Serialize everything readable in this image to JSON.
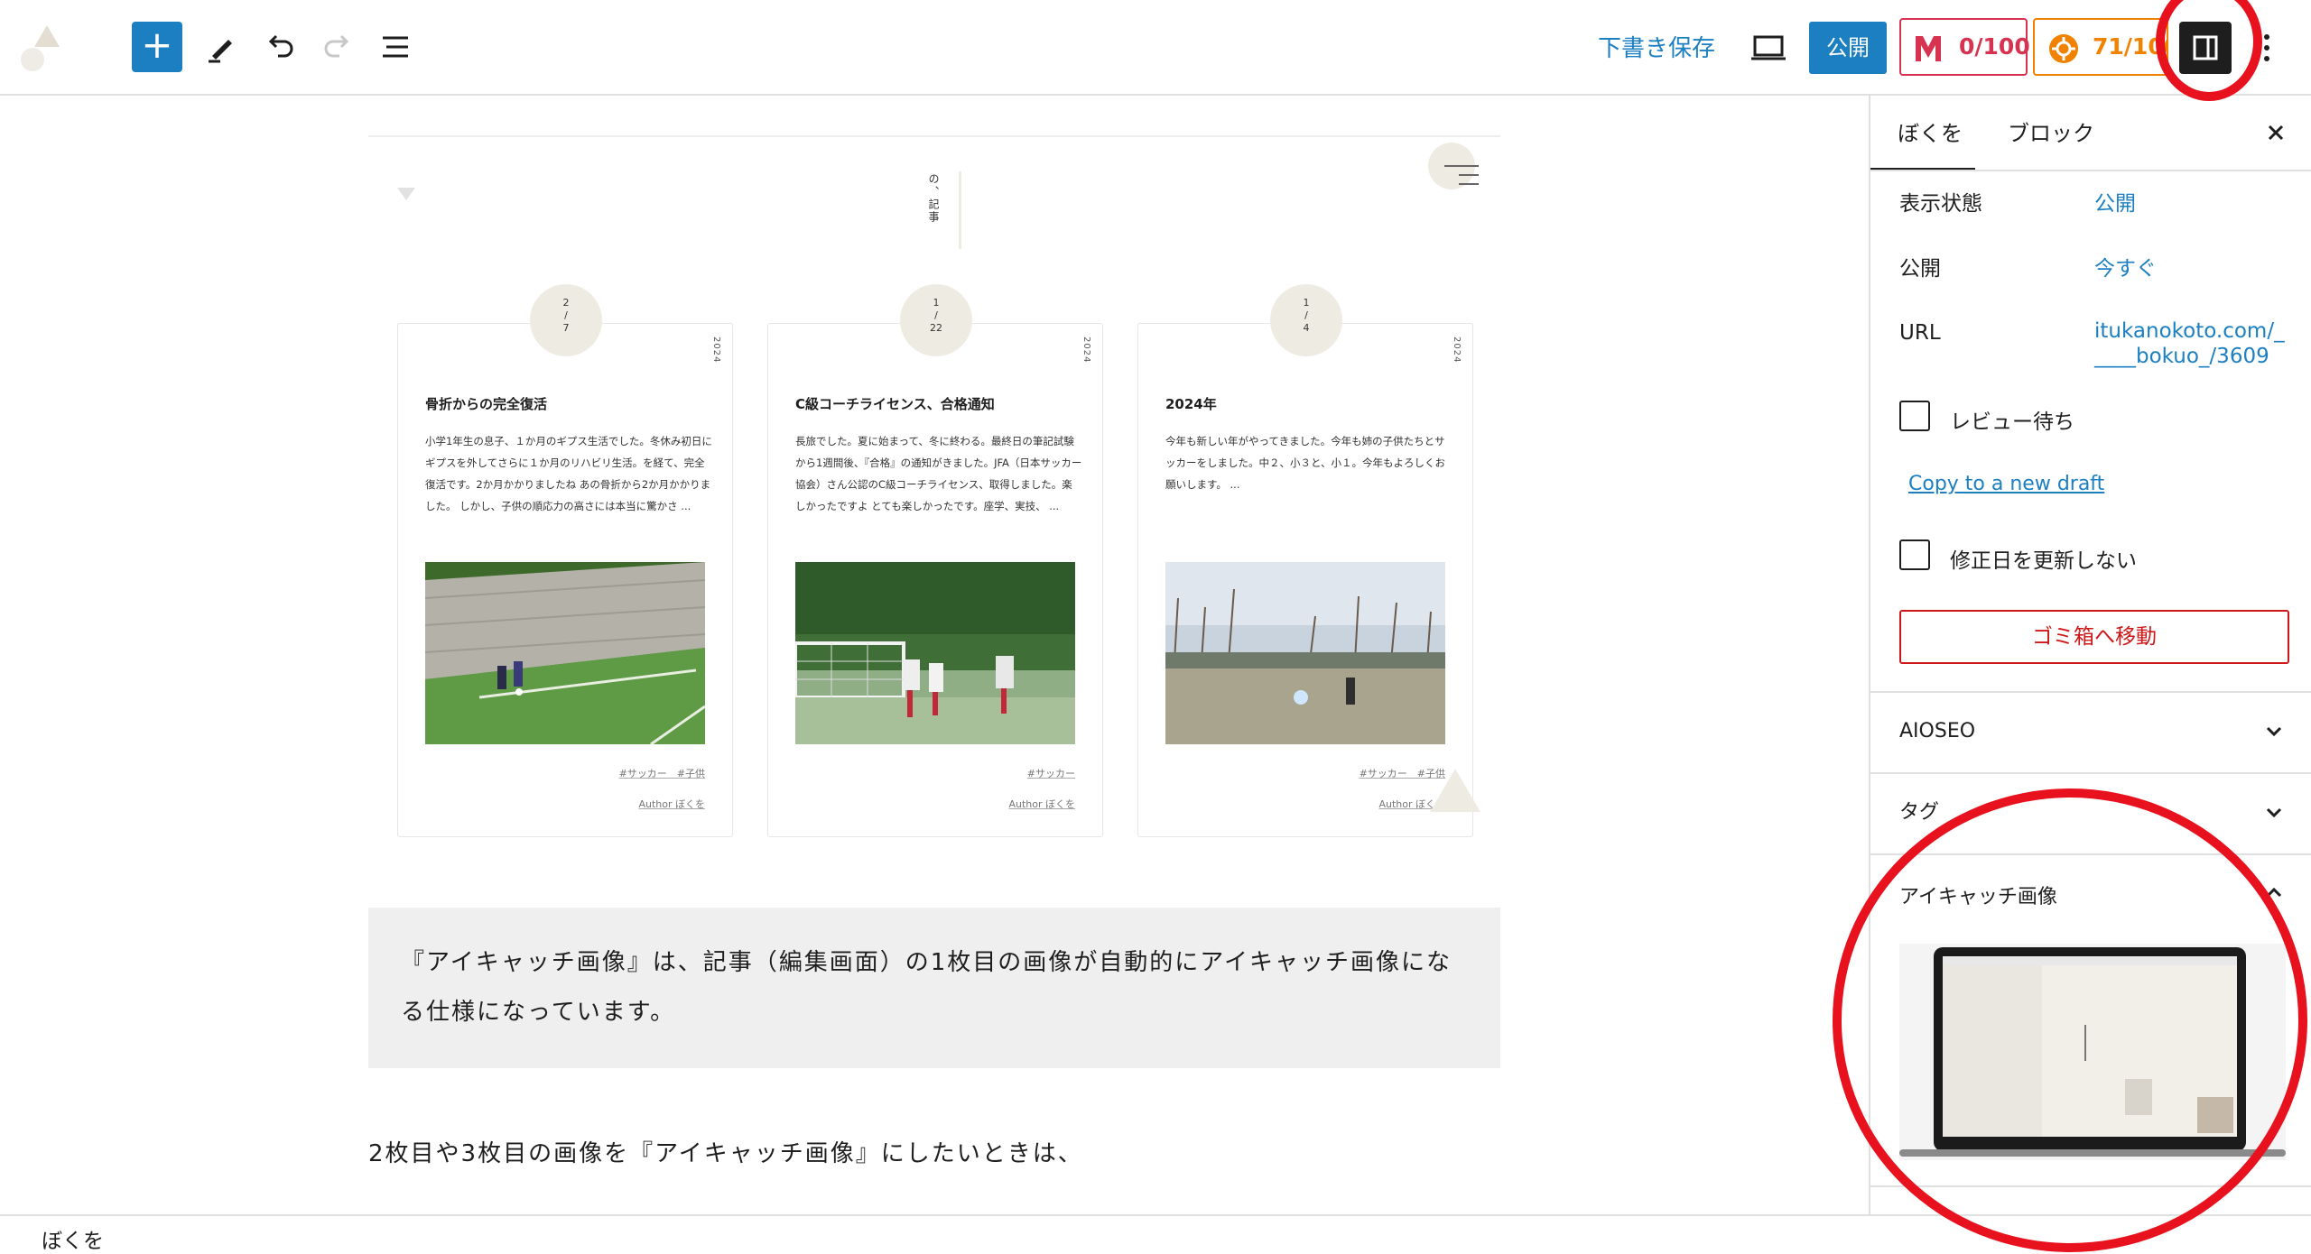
{
  "toolbar": {
    "save_draft_label": "下書き保存",
    "publish_label": "公開",
    "seo_score": "0/100",
    "aioseo_score": "71/100"
  },
  "canvas": {
    "header_vertical_text": "の、記事",
    "cards": [
      {
        "month": "2",
        "day": "7",
        "year": "2024",
        "title": "骨折からの完全復活",
        "excerpt": "小学1年生の息子、１か月のギプス生活でした。冬休み初日にギプスを外してさらに１か月のリハビリ生活。を経て、完全復活です。2か月かかりましたね あの骨折から2か月かかりました。 しかし、子供の順応力の高さには本当に驚かさ ...",
        "tags": "#サッカー　#子供",
        "author": "Author ぼくを"
      },
      {
        "month": "1",
        "day": "22",
        "year": "2024",
        "title": "C級コーチライセンス、合格通知",
        "excerpt": "長旅でした。夏に始まって、冬に終わる。最終日の筆記試験から1週間後、『合格』の通知がきました。JFA（日本サッカー協会）さん公認のC級コーチライセンス、取得しました。楽しかったですよ とても楽しかったです。座学、実技、 ...",
        "tags": "#サッカー",
        "author": "Author ぼくを"
      },
      {
        "month": "1",
        "day": "4",
        "year": "2024",
        "title": "2024年",
        "excerpt": "今年も新しい年がやってきました。今年も姉の子供たちとサッカーをしました。中２、小３と、小１。今年もよろしくお願いします。 ...",
        "tags": "#サッカー　#子供",
        "author": "Author ぼくを"
      }
    ],
    "quote_text": "『アイキャッチ画像』は、記事（編集画面）の1枚目の画像が自動的にアイキャッチ画像になる仕様になっています。",
    "paragraph_text": "2枚目や3枚目の画像を『アイキャッチ画像』にしたいときは、"
  },
  "sidebar": {
    "tab_post": "ぼくを",
    "tab_block": "ブロック",
    "visibility_label": "表示状態",
    "visibility_value": "公開",
    "publish_label": "公開",
    "publish_value": "今すぐ",
    "url_label": "URL",
    "url_value_line1": "itukanokoto.com/_",
    "url_value_line2": "____bokuo_/3609",
    "pending_review_label": "レビュー待ち",
    "copy_draft_label": "Copy to a new draft",
    "no_update_date_label": "修正日を更新しない",
    "trash_label": "ゴミ箱へ移動",
    "panels": {
      "aioseo": "AIOSEO",
      "tags": "タグ",
      "featured_image": "アイキャッチ画像"
    }
  },
  "statusbar": {
    "breadcrumb": "ぼくを"
  },
  "colors": {
    "accent": "#1c7fc1",
    "annotation": "#e8121f",
    "danger": "#cc1818"
  }
}
